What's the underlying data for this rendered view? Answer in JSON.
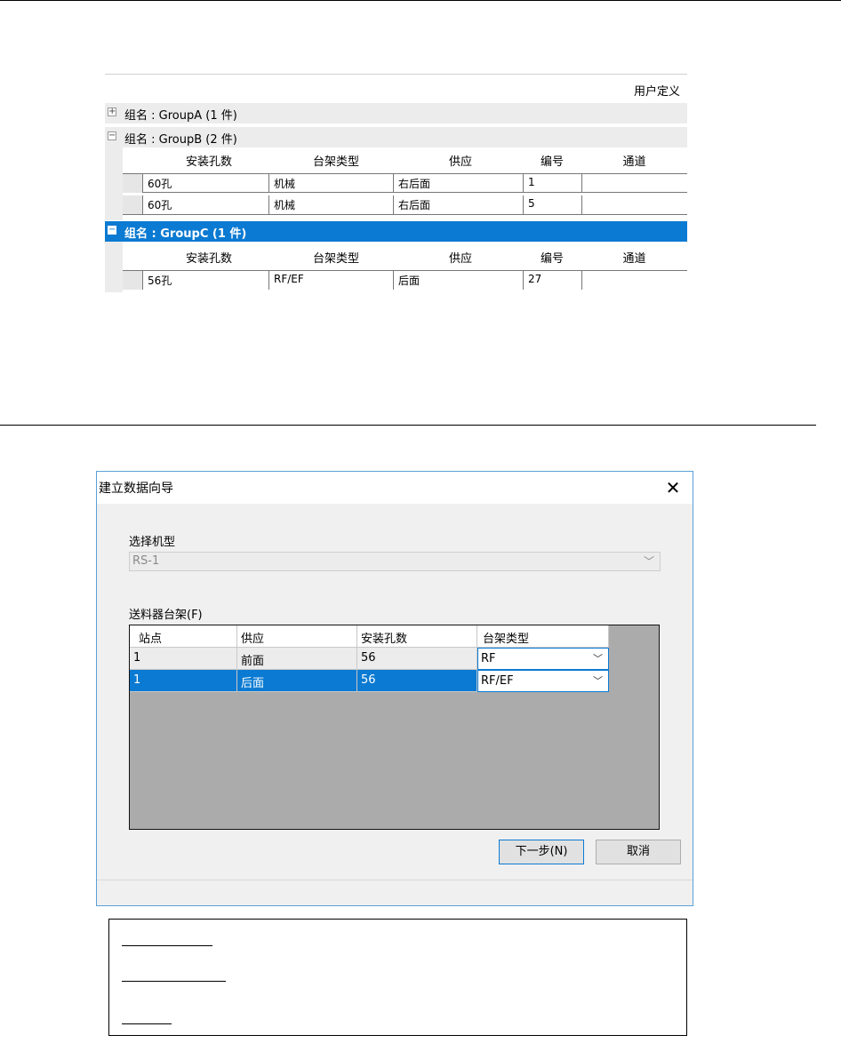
{
  "grid_panel": {
    "custom_label": "用户定义",
    "groups": [
      {
        "text": "组名 : GroupA (1 件)",
        "toggle": "+",
        "selected": false
      },
      {
        "text": "组名 : GroupB (2 件)",
        "toggle": "−",
        "selected": false
      },
      {
        "text": "组名 : GroupC (1 件)",
        "toggle": "−",
        "selected": true
      }
    ],
    "columns": [
      "安装孔数",
      "台架类型",
      "供应",
      "编号",
      "通道"
    ],
    "group_b_rows": [
      [
        "60孔",
        "机械",
        "右后面",
        "1",
        ""
      ],
      [
        "60孔",
        "机械",
        "右后面",
        "5",
        ""
      ]
    ],
    "group_c_rows": [
      [
        "56孔",
        "RF/EF",
        "后面",
        "27",
        ""
      ]
    ]
  },
  "dialog": {
    "title": "建立数据向导",
    "close_icon": "close-icon",
    "model_label": "选择机型",
    "model_value": "RS-1",
    "feeder_label": "送料器台架(F)",
    "columns": [
      "站点",
      "供应",
      "安装孔数",
      "台架类型"
    ],
    "rows": [
      {
        "station": "1",
        "supply": "前面",
        "holes": "56",
        "type": "RF",
        "selected": false
      },
      {
        "station": "1",
        "supply": "后面",
        "holes": "56",
        "type": "RF/EF",
        "selected": true
      }
    ],
    "next_button": "下一步(N)",
    "cancel_button": "取消"
  },
  "colors": {
    "selection_blue": "#0a7ad2",
    "grid_background": "#ababab"
  }
}
